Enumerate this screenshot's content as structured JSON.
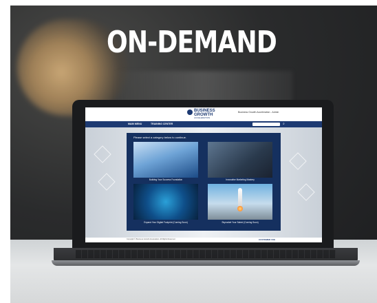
{
  "headline": "ON-DEMAND",
  "site": {
    "logo_line1": "BUSINESS",
    "logo_line2": "GROWTH",
    "logo_sub": "ACCELERATION",
    "user_label": "Business Growth Acceleration - Admin",
    "nav": [
      "MAIN MENU",
      "TRAINING CENTER"
    ],
    "search_placeholder": "Search",
    "prompt": "Please select a category below to continue.",
    "tiles": [
      {
        "label": "Building Your Success Foundation",
        "image": "businessman-skyscrapers"
      },
      {
        "label": "Innovative Marketing Mastery",
        "image": "marketing-laptop"
      },
      {
        "label": "Expand Your Digital Footprint (Coming Soon)",
        "image": "circuit-map"
      },
      {
        "label": "Skyrocket Your Sales! (Coming Soon)",
        "image": "rocket-launch"
      }
    ],
    "footer_copy": "Copyright © Business Growth Acceleration. All Rights Reserved.",
    "footer_logo": "CUSTOMER VUE"
  },
  "colors": {
    "brand_navy": "#1d3a72",
    "panel": "#15305f",
    "headline": "#ffffff"
  }
}
